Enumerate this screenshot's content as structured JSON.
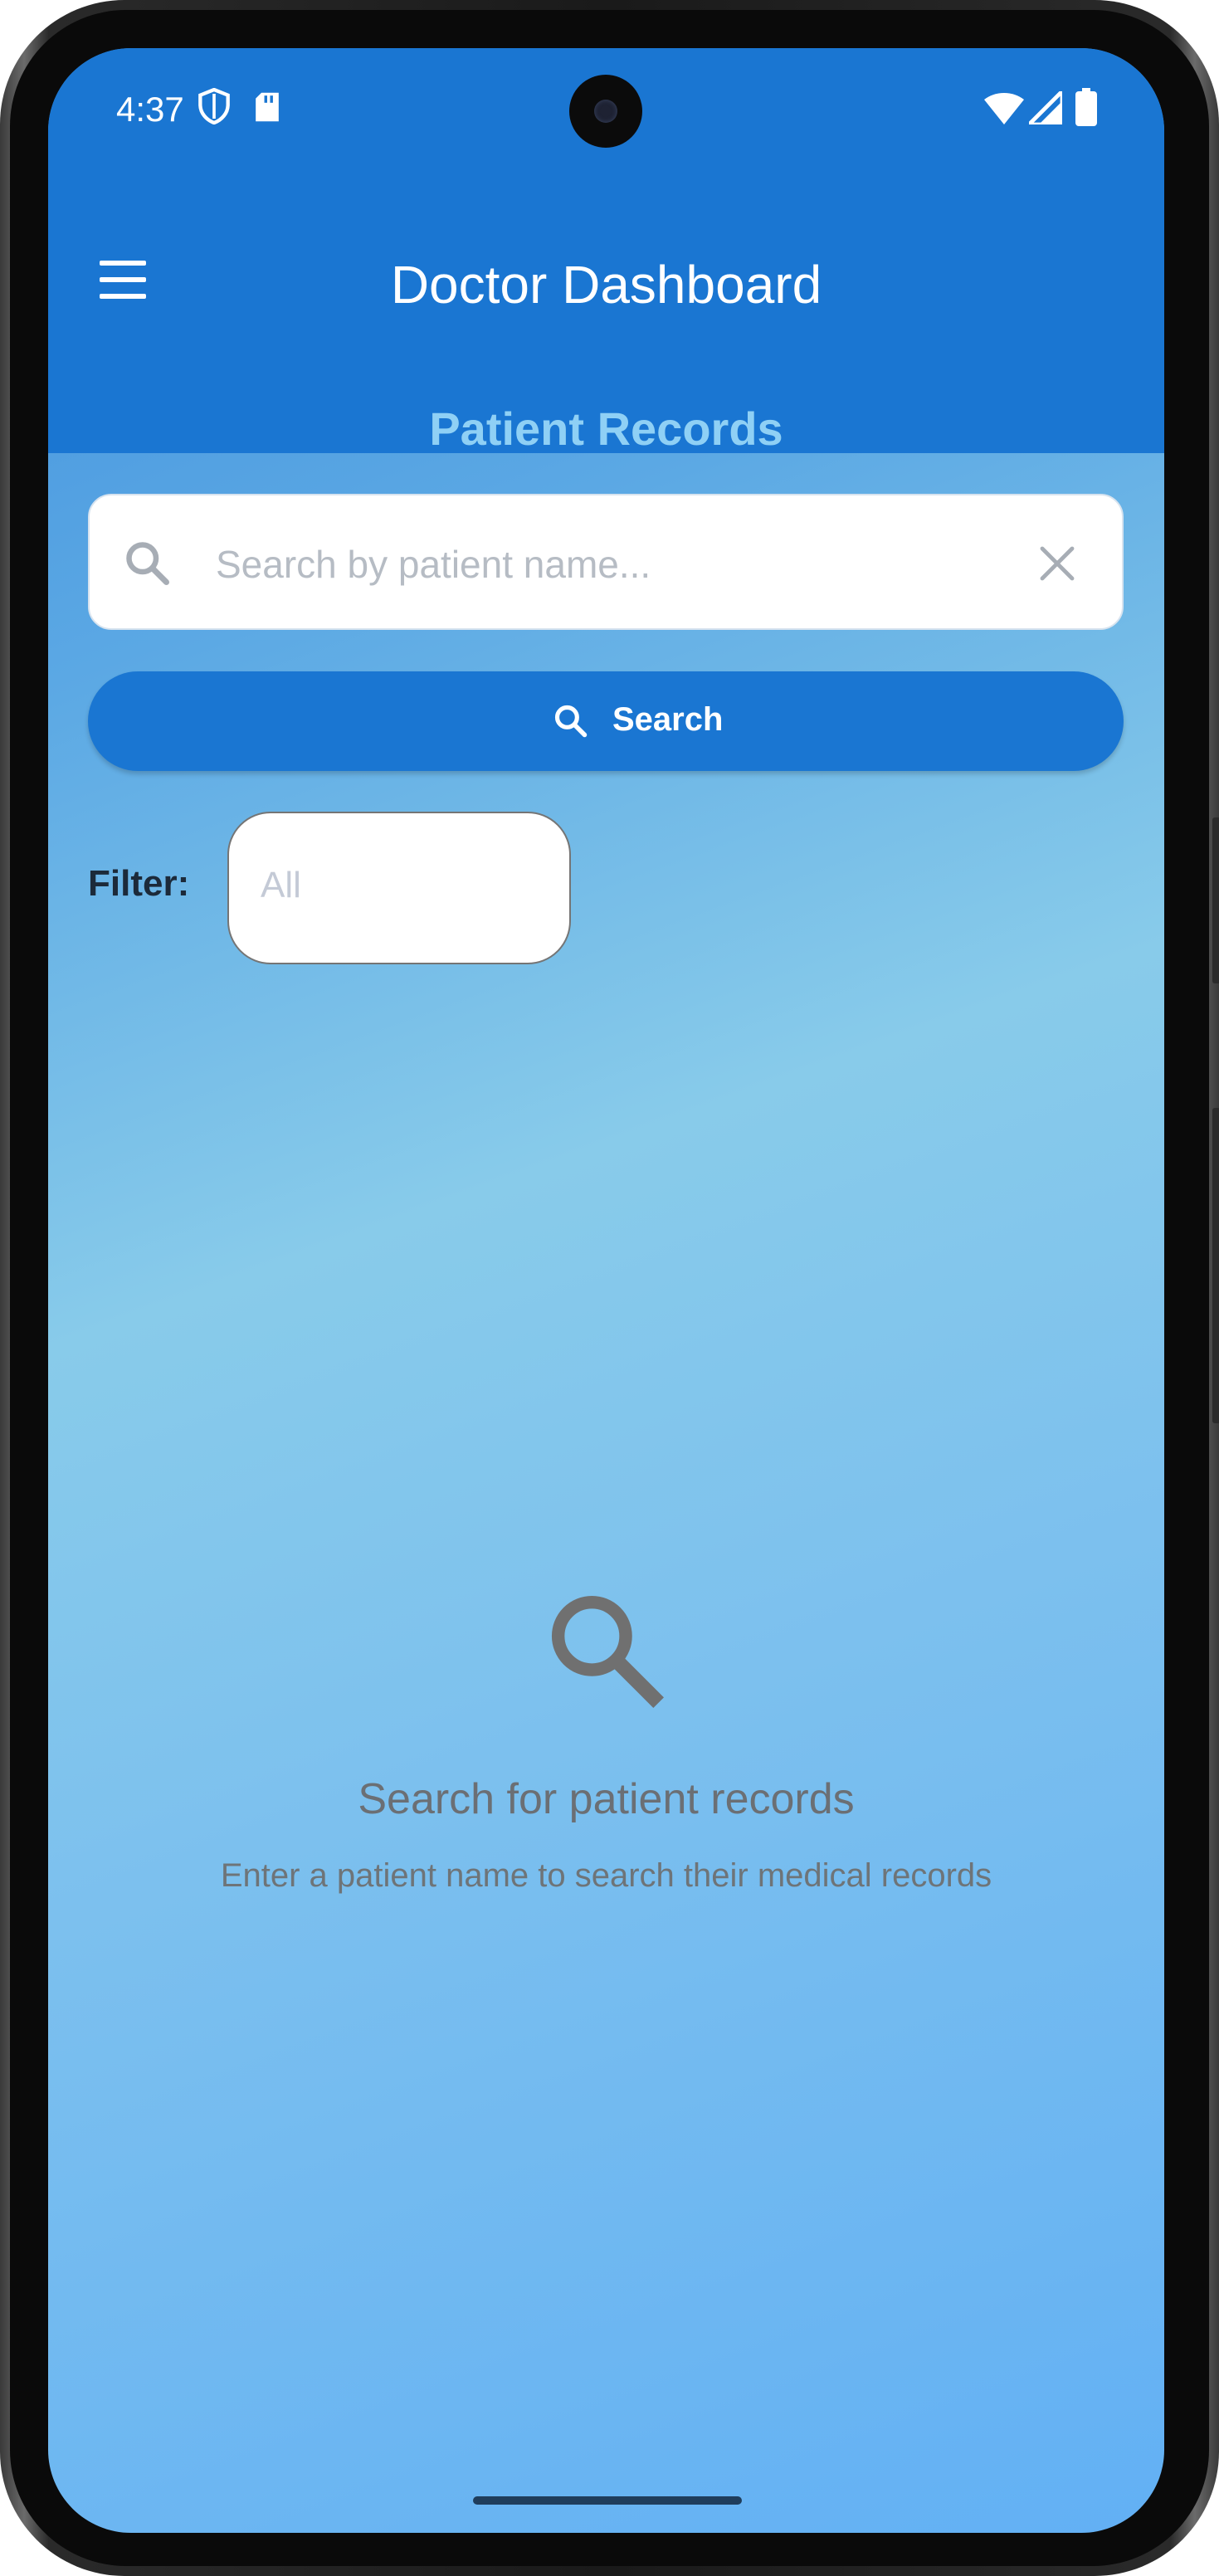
{
  "status_bar": {
    "time": "4:37",
    "left_icons": [
      "shield-icon",
      "sd-card-icon"
    ],
    "right_icons": [
      "wifi-icon",
      "signal-icon",
      "battery-icon"
    ]
  },
  "app_bar": {
    "menu_icon": "menu-icon",
    "title": "Doctor Dashboard",
    "subtitle": "Patient Records"
  },
  "search": {
    "placeholder": "Search by patient name...",
    "value": "",
    "leading_icon": "search-icon",
    "trailing_icon": "close-icon",
    "button_label": "Search",
    "button_icon": "search-icon"
  },
  "filter": {
    "label": "Filter:",
    "selected": "All"
  },
  "empty_state": {
    "icon": "search-icon",
    "title": "Search for patient records",
    "message": "Enter a patient name to search their medical records"
  },
  "colors": {
    "primary": "#1a76d2",
    "subtitle": "#8fd0f5",
    "background_gradient": [
      "#3f8fdc",
      "#88cbea",
      "#62b0f4"
    ]
  }
}
